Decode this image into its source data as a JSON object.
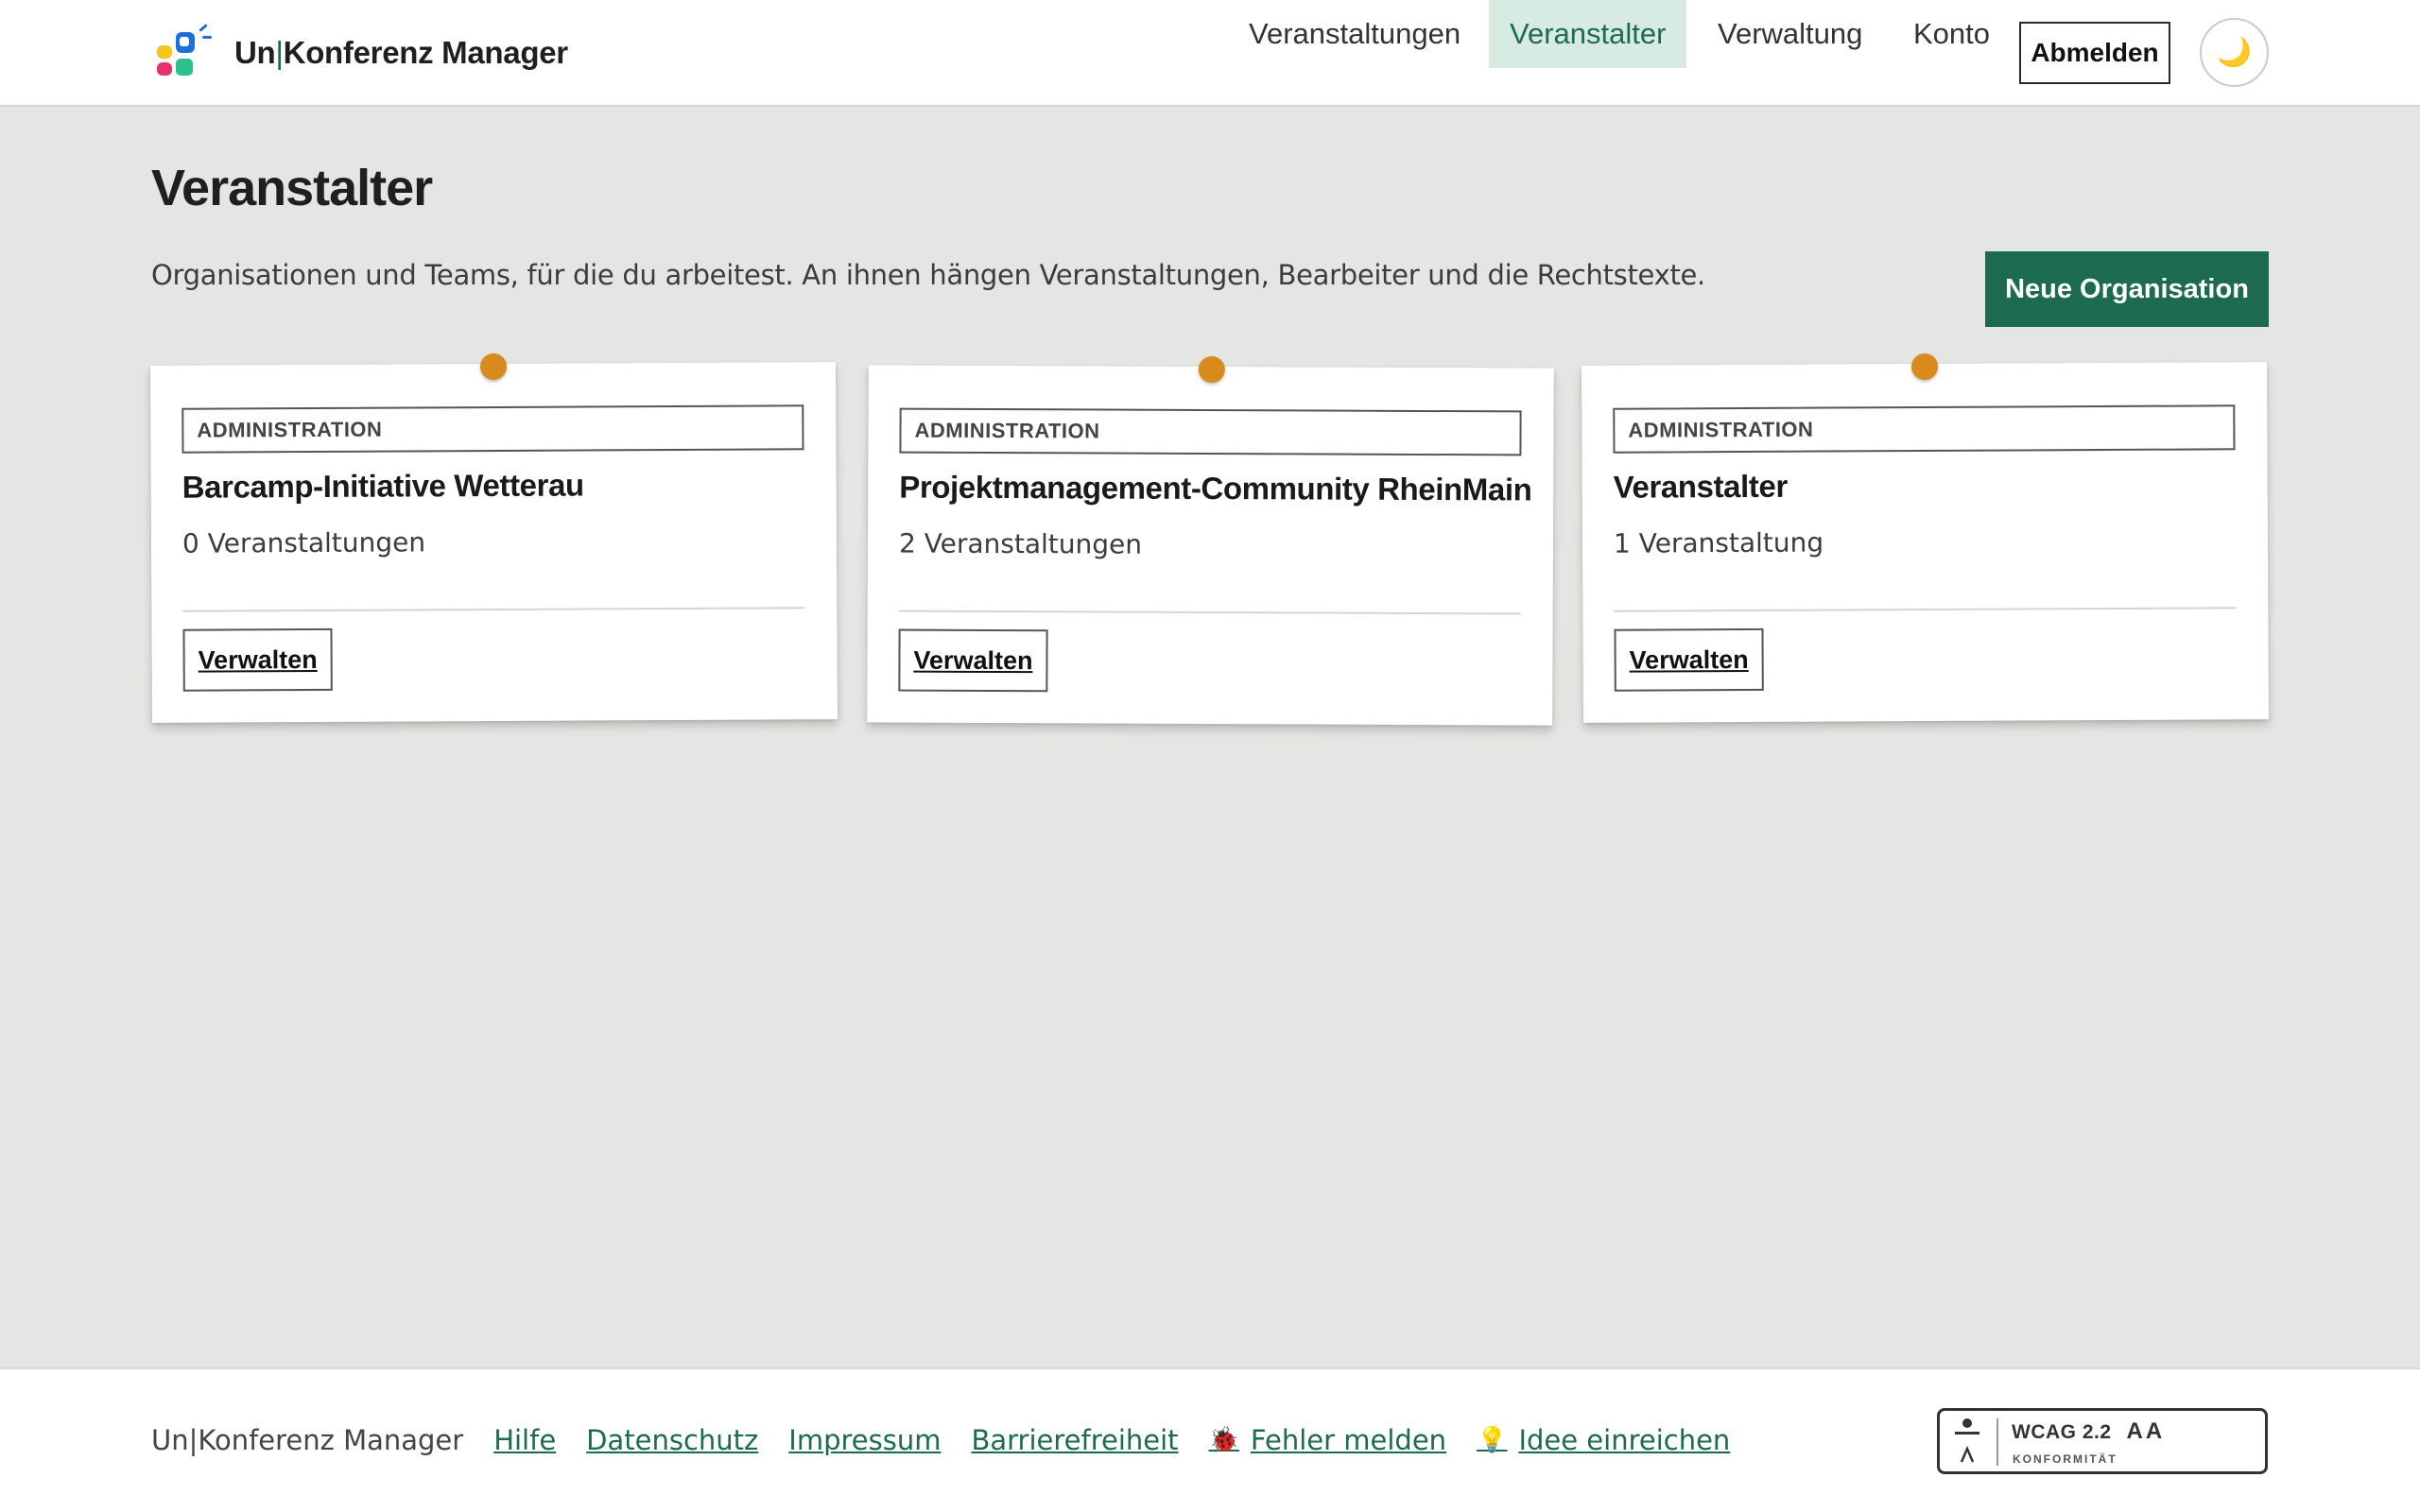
{
  "app": {
    "name_part1": "Un",
    "name_sep": "|",
    "name_part2": "Konferenz Manager"
  },
  "nav": {
    "items": [
      {
        "label": "Veranstaltungen",
        "active": false
      },
      {
        "label": "Veranstalter",
        "active": true
      },
      {
        "label": "Verwaltung",
        "active": false
      },
      {
        "label": "Konto",
        "active": false
      }
    ],
    "logout_label": "Abmelden",
    "theme_icon": "moon-icon",
    "theme_glyph": "🌙"
  },
  "page": {
    "title": "Veranstalter",
    "lead": "Organisationen und Teams, für die du arbeitest. An ihnen hängen Veranstaltungen, Bearbeiter und die Rechtstexte.",
    "new_org_label": "Neue Organisation"
  },
  "orgs": [
    {
      "role": "ADMINISTRATION",
      "name": "Barcamp-Initiative Wetterau",
      "count": "0 Veranstaltungen",
      "action": "Verwalten"
    },
    {
      "role": "ADMINISTRATION",
      "name": "Projektmanagement-Community RheinMain",
      "count": "2 Veranstaltungen",
      "action": "Verwalten"
    },
    {
      "role": "ADMINISTRATION",
      "name": "Veranstalter",
      "count": "1 Veranstaltung",
      "action": "Verwalten"
    }
  ],
  "footer": {
    "brand": "Un|Konferenz Manager",
    "links": {
      "help": "Hilfe",
      "privacy": "Datenschutz",
      "imprint": "Impressum",
      "accessibility": "Barrierefreiheit",
      "bug": "Fehler melden",
      "idea": "Idee einreichen"
    },
    "bug_glyph": "🐞",
    "idea_glyph": "💡",
    "wcag": {
      "title": "WCAG 2.2",
      "level": "AA",
      "sub": "KONFORMITÄT"
    }
  },
  "colors": {
    "accent": "#1d6b4f",
    "nav_active_bg": "#d8ebe2",
    "pin": "#d98a1c",
    "page_bg": "#e4e6e3"
  }
}
